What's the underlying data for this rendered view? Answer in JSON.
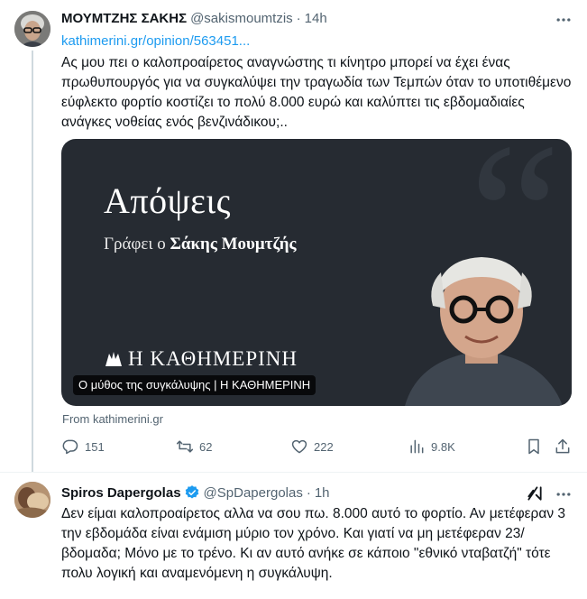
{
  "tweet1": {
    "author_name": "ΜΟΥΜΤΖΗΣ ΣΑΚΗΣ",
    "handle": "@sakismoumtzis",
    "dot": "·",
    "time": "14h",
    "link": "kathimerini.gr/opinion/563451...",
    "text": "Ας μου πει ο καλοπροαίρετος αναγνώστης τι κίνητρο μπορεί να έχει ένας πρωθυπουργός για να συγκαλύψει την τραγωδία των Τεμπών όταν το υποτιθέμενο εύφλεκτο φορτίο κοστίζει το πολύ 8.000 ευρώ και καλύπτει τις εβδομαδιαίες ανάγκες νοθείας ενός βενζινάδικου;..",
    "card": {
      "title": "Απόψεις",
      "byline_prefix": "Γράφει ο",
      "byline_author": "Σάκης Μουμτζής",
      "brand": "Η ΚΑΘΗΜΕΡΙΝΗ",
      "caption": "Ο μύθος της συγκάλυψης | Η ΚΑΘΗΜΕΡΙΝΗ",
      "source": "From kathimerini.gr"
    },
    "actions": {
      "replies": "151",
      "reposts": "62",
      "likes": "222",
      "views": "9.8K"
    }
  },
  "tweet2": {
    "author_name": "Spiros Dapergolas",
    "handle": "@SpDapergolas",
    "dot": "·",
    "time": "1h",
    "text": "Δεν είμαι καλοπροαίρετος αλλα να σου πω. 8.000 αυτό το φορτίο. Αν μετέφεραν 3 την εβδομάδα είναι ενάμιση μύριο τον χρόνο. Και γιατί να μη μετέφεραν 23/βδομαδα; Μόνο με το τρένο. Κι αν αυτό ανήκε σε κάποιο \"εθνικό νταβατζή\"  τότε πολυ λογική και αναμενόμενη η συγκάλυψη.",
    "verified": true
  },
  "icons": {
    "more": "more-horizontal-icon",
    "reply": "reply-icon",
    "retweet": "retweet-icon",
    "like": "heart-icon",
    "views": "views-icon",
    "bookmark": "bookmark-icon",
    "share": "share-icon",
    "grok": "grok-icon",
    "verified": "verified-badge-icon"
  },
  "colors": {
    "accent": "#1d9bf0",
    "secondary_text": "#536471",
    "card_background": "#262b32"
  }
}
